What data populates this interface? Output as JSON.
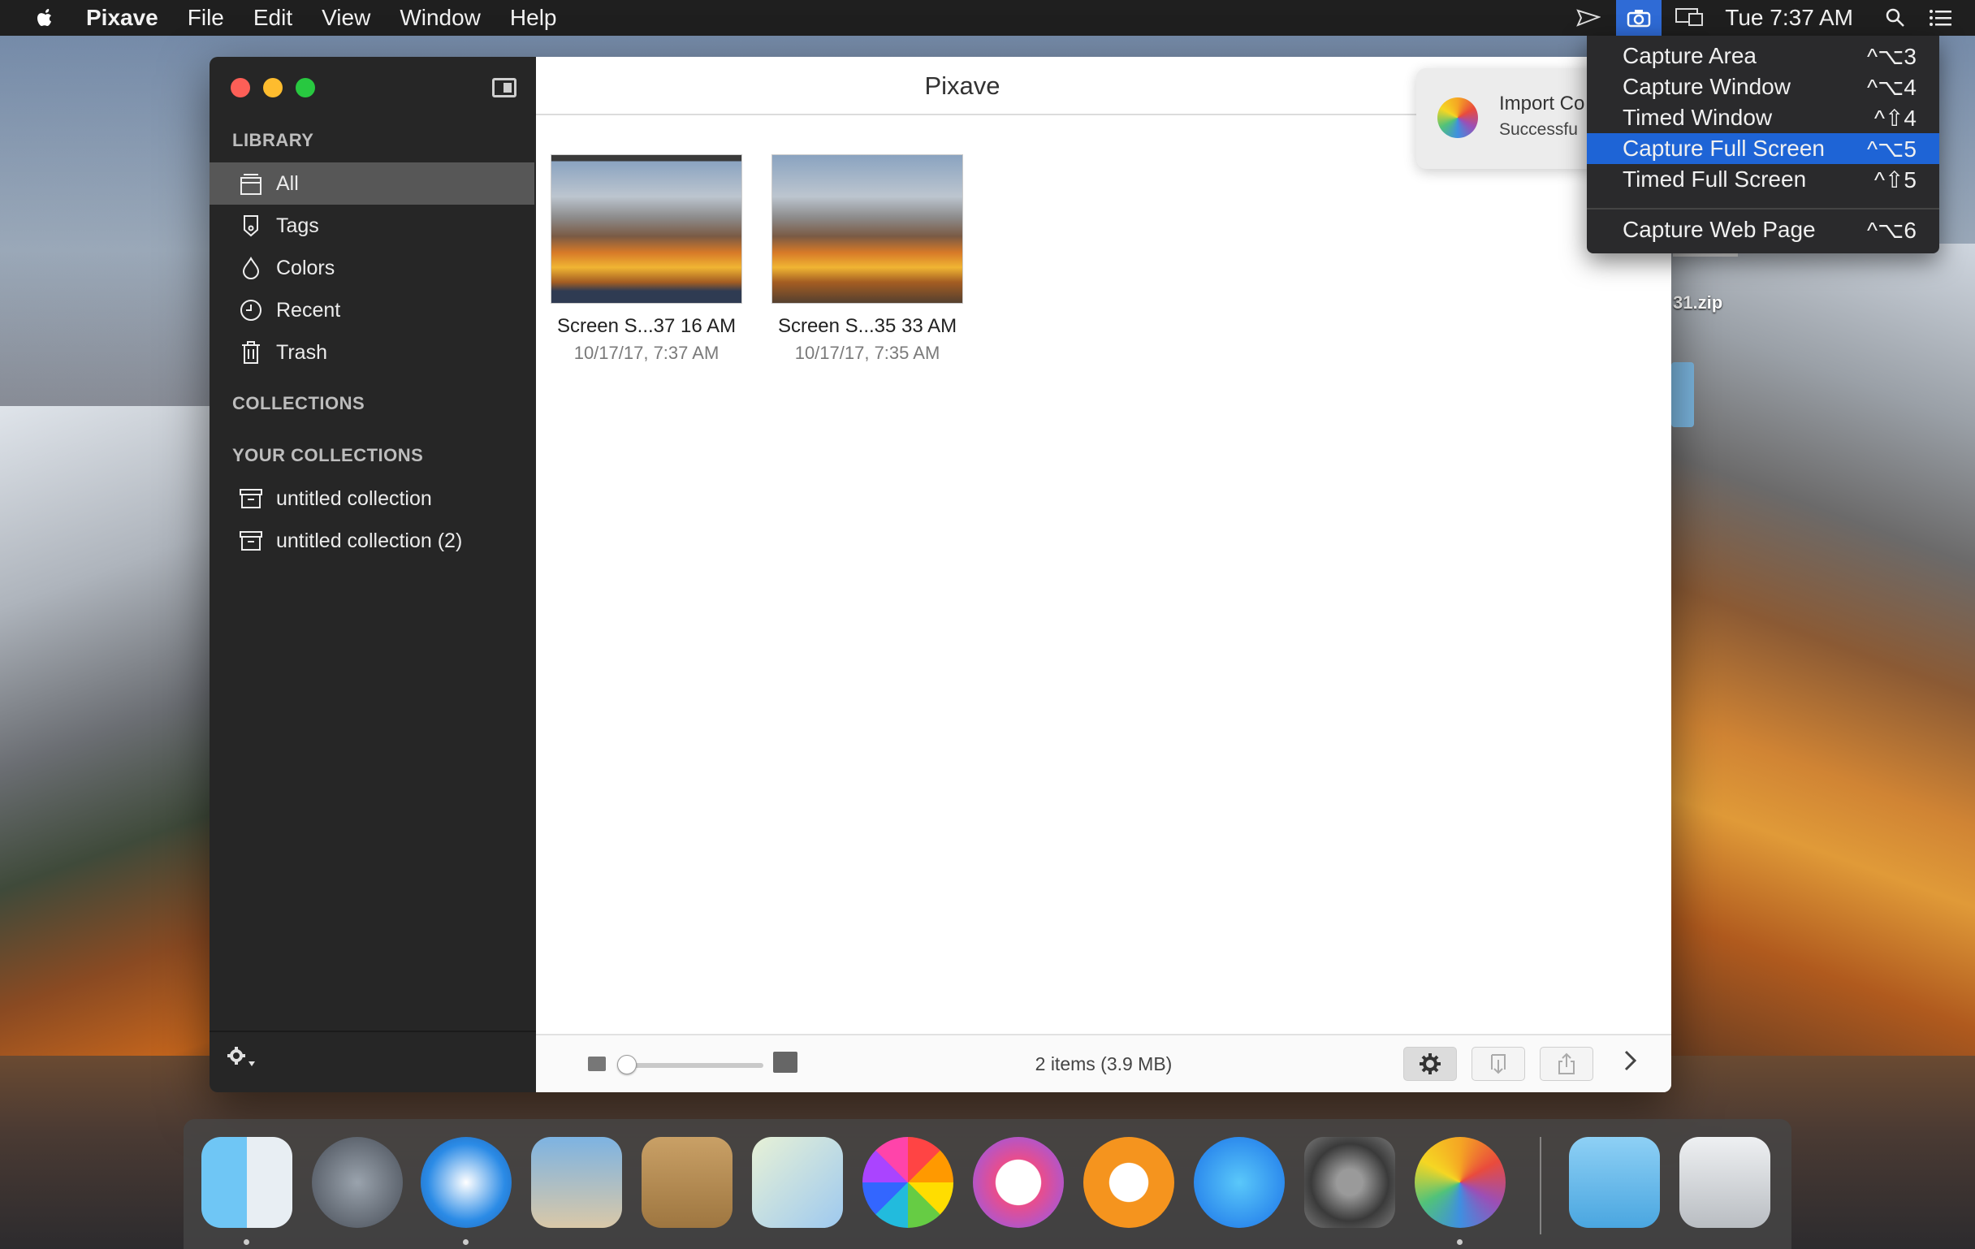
{
  "menubar": {
    "app_name": "Pixave",
    "menus": [
      "File",
      "Edit",
      "View",
      "Window",
      "Help"
    ],
    "clock": "Tue 7:37 AM"
  },
  "window": {
    "title": "Pixave"
  },
  "sidebar": {
    "library_header": "LIBRARY",
    "library_items": [
      {
        "label": "All",
        "icon": "tray-icon",
        "selected": true
      },
      {
        "label": "Tags",
        "icon": "tag-icon"
      },
      {
        "label": "Colors",
        "icon": "droplet-icon"
      },
      {
        "label": "Recent",
        "icon": "clock-icon"
      },
      {
        "label": "Trash",
        "icon": "trash-icon"
      }
    ],
    "collections_header": "COLLECTIONS",
    "your_collections_header": "YOUR COLLECTIONS",
    "collections": [
      {
        "label": "untitled collection",
        "icon": "collection-box-icon"
      },
      {
        "label": "untitled collection (2)",
        "icon": "collection-box-icon"
      }
    ]
  },
  "thumbnails": [
    {
      "name": "Screen S...37 16 AM",
      "date": "10/17/17, 7:37 AM"
    },
    {
      "name": "Screen S...35 33 AM",
      "date": "10/17/17, 7:35 AM"
    }
  ],
  "statusbar": {
    "count": "2 items (3.9 MB)"
  },
  "notification": {
    "title": "Import Co",
    "body": "Successfu"
  },
  "capture_menu": {
    "items": [
      {
        "label": "Capture Area",
        "shortcut": "^⌥3"
      },
      {
        "label": "Capture Window",
        "shortcut": "^⌥4"
      },
      {
        "label": "Timed Window",
        "shortcut": "^⇧4"
      },
      {
        "label": "Capture Full Screen",
        "shortcut": "^⌥5",
        "highlighted": true
      },
      {
        "label": "Timed Full Screen",
        "shortcut": "^⇧5"
      },
      {
        "label": "Capture Web Page",
        "shortcut": "^⌥6"
      }
    ]
  },
  "desktop": {
    "file_label": "31.zip"
  },
  "dock": {
    "apps": [
      "finder-icon",
      "launchpad-icon",
      "safari-icon",
      "mail-icon",
      "contacts-icon",
      "maps-icon",
      "photos-icon",
      "itunes-icon",
      "ibooks-icon",
      "app-store-icon",
      "system-preferences-icon",
      "pixave-icon",
      "downloads-folder-icon",
      "trash-can-icon"
    ]
  },
  "colors": {
    "accent": "#1e64d6",
    "sidebar_bg": "#262626",
    "selected_row": "#575757"
  }
}
